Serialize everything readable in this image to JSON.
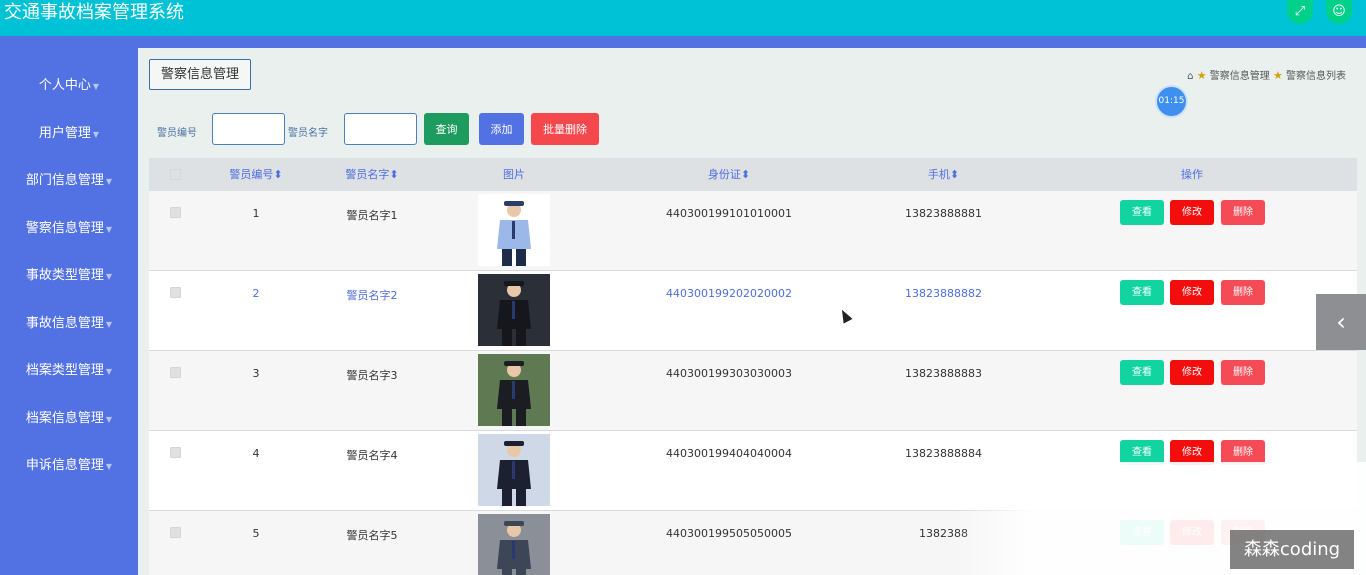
{
  "app": {
    "title": "交通事故档案管理系统"
  },
  "header_icons": [
    "fullscreen-icon",
    "user-icon"
  ],
  "sidebar": {
    "items": [
      {
        "label": "个人中心"
      },
      {
        "label": "用户管理"
      },
      {
        "label": "部门信息管理"
      },
      {
        "label": "警察信息管理"
      },
      {
        "label": "事故类型管理"
      },
      {
        "label": "事故信息管理"
      },
      {
        "label": "档案类型管理"
      },
      {
        "label": "档案信息管理"
      },
      {
        "label": "申诉信息管理"
      }
    ]
  },
  "page": {
    "title": "警察信息管理",
    "breadcrumb": [
      "警察信息管理",
      "警察信息列表"
    ],
    "clock": "01:15"
  },
  "search": {
    "id_label": "警员编号",
    "id_value": "",
    "name_label": "警员名字",
    "name_value": "",
    "query_label": "查询",
    "add_label": "添加",
    "batch_delete_label": "批量删除"
  },
  "table": {
    "headers": {
      "id": "警员编号",
      "name": "警员名字",
      "photo": "图片",
      "idcard": "身份证",
      "phone": "手机",
      "actions": "操作"
    },
    "action_labels": {
      "view": "查看",
      "edit": "修改",
      "delete": "删除"
    },
    "rows": [
      {
        "id": "1",
        "name": "警员名字1",
        "idcard": "440300199101010001",
        "phone": "13823888881",
        "photo_colors": [
          "#7d9ad6",
          "#2a3d6a"
        ]
      },
      {
        "id": "2",
        "name": "警员名字2",
        "idcard": "440300199202020002",
        "phone": "13823888882",
        "photo_colors": [
          "#2b2f38",
          "#15171c"
        ]
      },
      {
        "id": "3",
        "name": "警员名字3",
        "idcard": "440300199303030003",
        "phone": "13823888883",
        "photo_colors": [
          "#5f7a52",
          "#1b1d22"
        ]
      },
      {
        "id": "4",
        "name": "警员名字4",
        "idcard": "440300199404040004",
        "phone": "13823888884",
        "photo_colors": [
          "#cfd8e6",
          "#1c2030"
        ]
      },
      {
        "id": "5",
        "name": "警员名字5",
        "idcard": "440300199505050005",
        "phone": "1382388",
        "photo_colors": [
          "#8a8f98",
          "#3c4656"
        ]
      }
    ]
  },
  "watermark": "森森coding",
  "colors": {
    "topbar": "#00c2d6",
    "sidebar": "#5271e2",
    "query": "#1e9b5e",
    "add": "#5271e2",
    "batch_delete": "#f5484c",
    "view": "#12d4a0",
    "edit": "#f30d0d",
    "delete": "#f54b57"
  }
}
